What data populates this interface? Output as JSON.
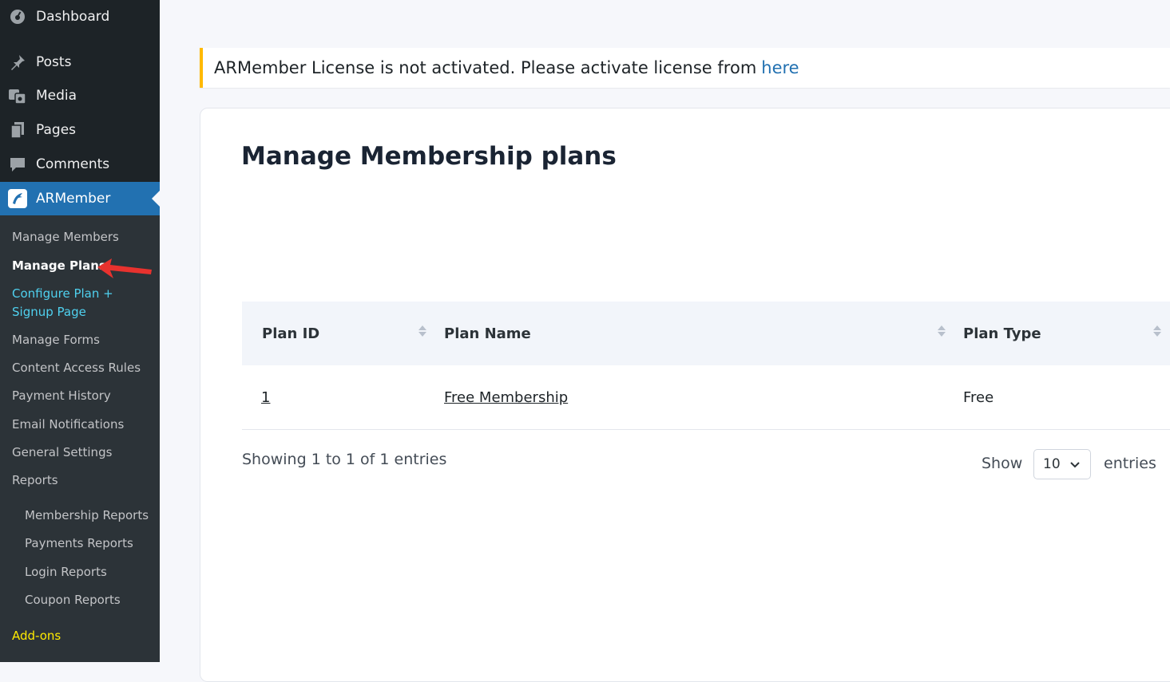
{
  "sidebar": {
    "top_items": [
      {
        "label": "Dashboard",
        "icon": "dashboard-icon"
      },
      {
        "label": "Posts",
        "icon": "pin-icon"
      },
      {
        "label": "Media",
        "icon": "media-icon"
      },
      {
        "label": "Pages",
        "icon": "pages-icon"
      },
      {
        "label": "Comments",
        "icon": "comment-icon"
      },
      {
        "label": "ARMember",
        "icon": "armember-icon"
      }
    ],
    "sub_items": [
      "Manage Members",
      "Manage Plans",
      "Configure Plan +",
      "Signup Page",
      "Manage Forms",
      "Content Access Rules",
      "Payment History",
      "Email Notifications",
      "General Settings",
      "Reports",
      "Membership Reports",
      "Payments Reports",
      "Login Reports",
      "Coupon Reports",
      "Add-ons"
    ],
    "active_color": "#2271b1",
    "bg_color": "#1d2327"
  },
  "notice": {
    "text": "ARMember License is not activated. Please activate license from",
    "link": "here",
    "border_color": "#ffb900"
  },
  "main": {
    "title": "Manage Membership plans",
    "table": {
      "headers": [
        "Plan ID",
        "Plan Name",
        "Plan Type"
      ],
      "rows": [
        {
          "id": "1",
          "name": "Free Membership",
          "type": "Free"
        }
      ]
    },
    "showing": "Showing 1 to 1 of 1 entries",
    "show_label": "Show",
    "entries_value": "10",
    "entries_label": "entries"
  }
}
